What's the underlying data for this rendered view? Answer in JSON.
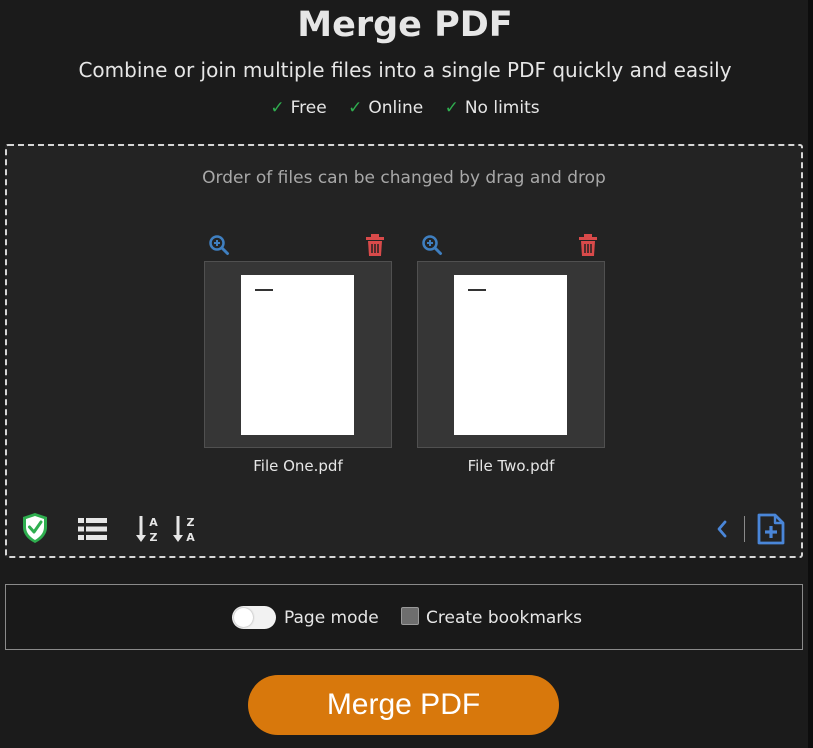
{
  "header": {
    "title": "Merge PDF",
    "subtitle": "Combine or join multiple files into a single PDF quickly and easily",
    "features": [
      "Free",
      "Online",
      "No limits"
    ],
    "check_glyph": "✓"
  },
  "dropzone": {
    "hint": "Order of files can be changed by drag and drop",
    "files": [
      {
        "name": "File One.pdf"
      },
      {
        "name": "File Two.pdf"
      }
    ],
    "toolbar_icons": [
      "shield-check-icon",
      "list-icon",
      "sort-az-icon",
      "sort-za-icon",
      "chevron-left-icon",
      "add-file-icon"
    ]
  },
  "options": {
    "page_mode_label": "Page mode",
    "page_mode_on": false,
    "bookmarks_label": "Create bookmarks",
    "bookmarks_checked": false
  },
  "action": {
    "merge_label": "Merge PDF"
  },
  "colors": {
    "accent": "#d8780c",
    "check": "#2fae4f",
    "zoom_icon": "#3f7fc0",
    "trash_icon": "#d84a4a",
    "add_file_icon": "#4a86d8"
  }
}
